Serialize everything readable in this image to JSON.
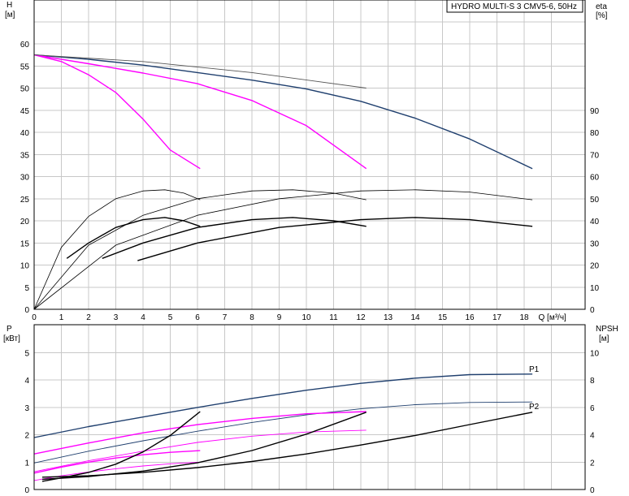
{
  "chart_data": [
    {
      "type": "line",
      "title": "HYDRO MULTI-S 3 CMV5-6, 50Hz",
      "ylabel_left": "H",
      "ylabel_left_unit": "[м]",
      "ylabel_right": "eta",
      "ylabel_right_unit": "[%]",
      "xlabel": "Q [м³/ч]",
      "xlim": [
        0,
        19
      ],
      "ylim": [
        0,
        65
      ],
      "ylim_right": [
        0,
        130
      ],
      "grid": true,
      "x_ticks": [
        "0",
        "1",
        "2",
        "3",
        "4",
        "5",
        "6",
        "7",
        "8",
        "9",
        "10",
        "11",
        "12",
        "13",
        "14",
        "15",
        "16",
        "17",
        "18",
        "Q [м³/ч]"
      ],
      "y_ticks": [
        "0",
        "5",
        "10",
        "15",
        "20",
        "25",
        "30",
        "35",
        "40",
        "45",
        "50",
        "55",
        "60"
      ],
      "y_ticks_right": [
        "0",
        "10",
        "20",
        "30",
        "40",
        "50",
        "60",
        "70",
        "80",
        "90"
      ],
      "series": [
        {
          "color": "#1f3f6e",
          "axis": "left",
          "width": 1.4,
          "x": [
            0,
            2,
            4,
            6,
            8,
            10,
            12,
            14,
            16,
            18.3
          ],
          "y": [
            57.5,
            56.5,
            55.2,
            53.5,
            51.8,
            49.8,
            47,
            43.2,
            38.5,
            31.8
          ]
        },
        {
          "color": "#ff00ff",
          "axis": "left",
          "width": 1.4,
          "x": [
            0,
            2,
            4,
            6,
            8,
            10,
            12.2
          ],
          "y": [
            57.5,
            55.5,
            53.4,
            51,
            47.2,
            41.5,
            31.8
          ]
        },
        {
          "color": "#ff00ff",
          "axis": "left",
          "width": 1.4,
          "x": [
            0,
            1,
            2,
            3,
            4,
            5,
            6.1
          ],
          "y": [
            57.5,
            56,
            53,
            49,
            43,
            36,
            31.8
          ]
        },
        {
          "color": "#555555",
          "axis": "left",
          "width": 0.9,
          "x": [
            0,
            4,
            8,
            12.2
          ],
          "y": [
            57.5,
            56,
            53.5,
            50
          ]
        },
        {
          "color": "#000000",
          "axis": "right",
          "width": 0.8,
          "x": [
            0,
            1,
            2,
            3,
            4,
            4.8,
            5.5,
            6.1
          ],
          "y": [
            0,
            28,
            42,
            50,
            53.5,
            54,
            52.5,
            49.5
          ]
        },
        {
          "color": "#000000",
          "axis": "right",
          "width": 0.8,
          "x": [
            0,
            2,
            4,
            6,
            8,
            9.5,
            11,
            12.2
          ],
          "y": [
            0,
            29,
            42.5,
            50,
            53.5,
            54,
            52.5,
            49.5
          ]
        },
        {
          "color": "#000000",
          "axis": "right",
          "width": 0.8,
          "x": [
            0,
            3,
            6,
            9,
            12,
            14,
            16,
            18.3
          ],
          "y": [
            0,
            29,
            42.5,
            50,
            53.5,
            54,
            53,
            49.5
          ]
        },
        {
          "color": "#000000",
          "axis": "right",
          "width": 1.4,
          "x": [
            1.2,
            2,
            3,
            4,
            4.8,
            5.5,
            6.1
          ],
          "y": [
            23,
            30,
            37,
            40.5,
            41.5,
            40,
            37.5
          ]
        },
        {
          "color": "#000000",
          "axis": "right",
          "width": 1.4,
          "x": [
            2.5,
            4,
            6,
            8,
            9.5,
            11,
            12.2
          ],
          "y": [
            23,
            30,
            37,
            40.5,
            41.5,
            40,
            37.5
          ]
        },
        {
          "color": "#000000",
          "axis": "right",
          "width": 1.4,
          "x": [
            3.8,
            6,
            9,
            12,
            14,
            16,
            18.3
          ],
          "y": [
            22,
            30,
            37,
            40.5,
            41.5,
            40.5,
            37.5
          ]
        }
      ]
    },
    {
      "type": "line",
      "ylabel_left": "P",
      "ylabel_left_unit": "[кВт]",
      "ylabel_right": "NPSH",
      "ylabel_right_unit": "[м]",
      "xlim": [
        0,
        19
      ],
      "ylim": [
        0,
        6
      ],
      "ylim_right": [
        0,
        12
      ],
      "grid": true,
      "y_ticks": [
        "0",
        "1",
        "2",
        "3",
        "4",
        "5"
      ],
      "y_ticks_right": [
        "0",
        "2",
        "4",
        "6",
        "8",
        "10"
      ],
      "annotations": [
        "P1",
        "P2"
      ],
      "series": [
        {
          "name": "P1",
          "color": "#1f3f6e",
          "axis": "left",
          "width": 1.4,
          "x": [
            0,
            2,
            4,
            6,
            8,
            10,
            12,
            14,
            16,
            18.3
          ],
          "y": [
            1.9,
            2.3,
            2.65,
            3.0,
            3.33,
            3.63,
            3.88,
            4.07,
            4.2,
            4.22
          ]
        },
        {
          "name": "P2",
          "color": "#1f3f6e",
          "axis": "left",
          "width": 0.9,
          "x": [
            0,
            2,
            4,
            6,
            8,
            10,
            12,
            14,
            16,
            18.3
          ],
          "y": [
            0.97,
            1.4,
            1.78,
            2.13,
            2.45,
            2.73,
            2.95,
            3.1,
            3.18,
            3.2
          ]
        },
        {
          "color": "#ff00ff",
          "axis": "left",
          "width": 1.4,
          "x": [
            0,
            2,
            4,
            6,
            8,
            10,
            12.2
          ],
          "y": [
            1.3,
            1.7,
            2.07,
            2.37,
            2.6,
            2.77,
            2.85
          ]
        },
        {
          "color": "#ff00ff",
          "axis": "left",
          "width": 0.9,
          "x": [
            0,
            2,
            4,
            6,
            8,
            10,
            12.2
          ],
          "y": [
            0.65,
            1.05,
            1.4,
            1.72,
            1.95,
            2.1,
            2.17
          ]
        },
        {
          "color": "#ff00ff",
          "axis": "left",
          "width": 1.4,
          "x": [
            0,
            1,
            2,
            3,
            4,
            5,
            6.1
          ],
          "y": [
            0.6,
            0.82,
            1.0,
            1.15,
            1.27,
            1.36,
            1.42
          ]
        },
        {
          "color": "#ff00ff",
          "axis": "left",
          "width": 0.9,
          "x": [
            0,
            1,
            2,
            3,
            4,
            5,
            6.1
          ],
          "y": [
            0.33,
            0.5,
            0.64,
            0.76,
            0.86,
            0.94,
            1.0
          ]
        },
        {
          "color": "#000000",
          "axis": "right",
          "width": 1.4,
          "x": [
            0.3,
            2,
            4,
            6,
            8,
            10,
            12,
            14,
            16,
            18.3
          ],
          "y": [
            0.9,
            1.0,
            1.25,
            1.6,
            2.05,
            2.6,
            3.25,
            3.95,
            4.75,
            5.65
          ]
        },
        {
          "color": "#000000",
          "axis": "right",
          "width": 1.4,
          "x": [
            0.3,
            2,
            4,
            6,
            8,
            10,
            12.2
          ],
          "y": [
            0.75,
            0.95,
            1.35,
            1.95,
            2.85,
            4.05,
            5.65
          ]
        },
        {
          "color": "#000000",
          "axis": "right",
          "width": 1.4,
          "x": [
            0.3,
            1,
            2,
            3,
            4,
            5,
            6.1
          ],
          "y": [
            0.6,
            0.85,
            1.25,
            1.85,
            2.75,
            3.95,
            5.7
          ]
        }
      ]
    }
  ]
}
